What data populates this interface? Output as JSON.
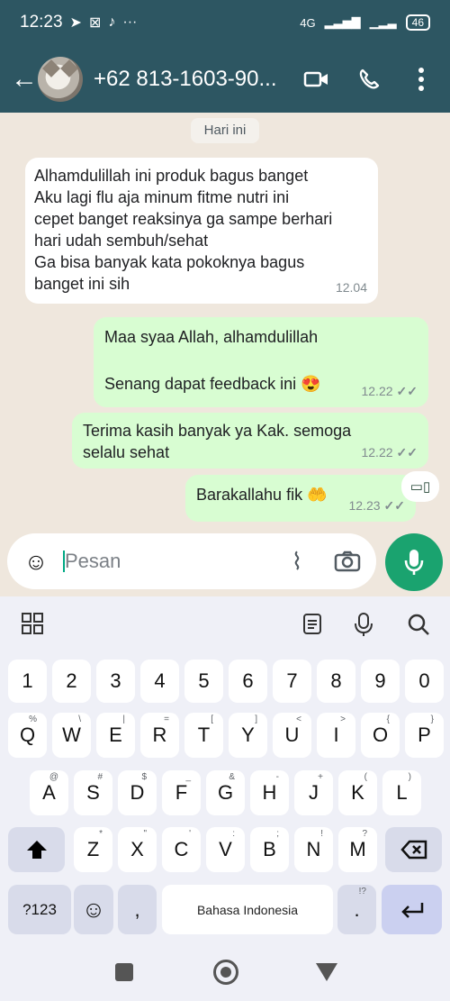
{
  "status": {
    "time": "12:23",
    "network": "4G",
    "battery": "46"
  },
  "header": {
    "contact": "+62 813-1603-90..."
  },
  "chat": {
    "date_chip": "Hari ini",
    "incoming": {
      "lines": [
        "Alhamdulillah ini produk bagus banget",
        "Aku lagi flu aja  minum fitme nutri ini",
        "cepet banget reaksinya ga sampe berhari",
        "hari udah sembuh/sehat",
        "Ga bisa banyak kata pokoknya bagus",
        "banget ini sih"
      ],
      "time": "12.04"
    },
    "outgoing": [
      {
        "line1": "Maa syaa Allah, alhamdulillah",
        "line2": "Senang dapat feedback ini 😍",
        "time": "12.22"
      },
      {
        "line1": "Terima kasih banyak ya Kak. semoga",
        "line2": "selalu sehat",
        "time": "12.22"
      },
      {
        "line1": "Barakallahu fik 🤲",
        "time": "12.23"
      }
    ]
  },
  "input": {
    "placeholder": "Pesan"
  },
  "keyboard": {
    "numbers": [
      "1",
      "2",
      "3",
      "4",
      "5",
      "6",
      "7",
      "8",
      "9",
      "0"
    ],
    "row1": [
      "Q",
      "W",
      "E",
      "R",
      "T",
      "Y",
      "U",
      "I",
      "O",
      "P"
    ],
    "row1_hints": [
      "%",
      "\\",
      "|",
      "=",
      "[",
      "]",
      "<",
      ">",
      "{",
      "}"
    ],
    "row2": [
      "A",
      "S",
      "D",
      "F",
      "G",
      "H",
      "J",
      "K",
      "L"
    ],
    "row2_hints": [
      "@",
      "#",
      "$",
      "_",
      "&",
      "-",
      "+",
      "(",
      ")"
    ],
    "row3": [
      "Z",
      "X",
      "C",
      "V",
      "B",
      "N",
      "M"
    ],
    "row3_hints": [
      "*",
      "\"",
      "'",
      ":",
      ";",
      "!",
      "?"
    ],
    "bottom": {
      "symbols": "?123",
      "comma": ",",
      "space": "Bahasa Indonesia",
      "period": ".",
      "period_hint": "!?"
    }
  }
}
